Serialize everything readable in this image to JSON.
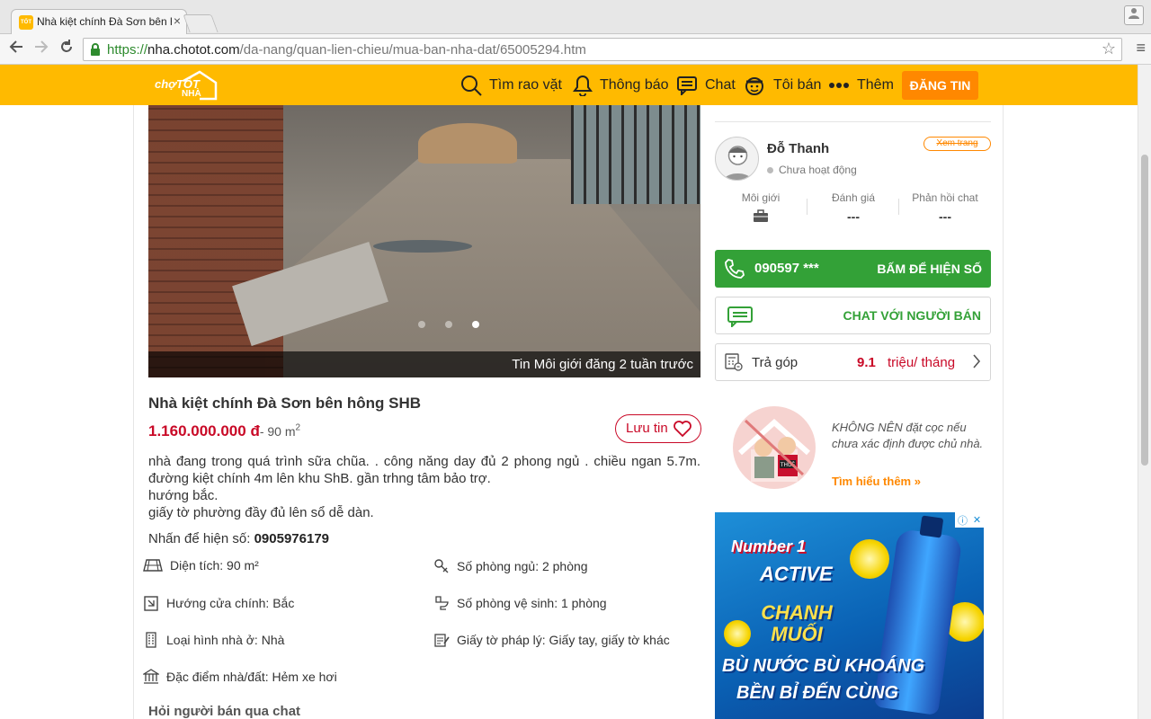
{
  "browser": {
    "tab_title": "Nhà kiệt chính Đà Sơn bên hông SHB",
    "tab_favicon_text": "TỐT",
    "tab_close": "×",
    "url_scheme": "https://",
    "url_host": "nha.chotot.com",
    "url_path": "/da-nang/quan-lien-chieu/mua-ban-nha-dat/65005294.htm"
  },
  "header": {
    "logo_text": "chợTỐT",
    "logo_sub": "NHÀ",
    "nav": [
      {
        "label": "Tìm rao vặt",
        "icon": "search-icon"
      },
      {
        "label": "Thông báo",
        "icon": "bell-icon"
      },
      {
        "label": "Chat",
        "icon": "chat-icon"
      },
      {
        "label": "Tôi bán",
        "icon": "seller-icon"
      },
      {
        "label": "Thêm",
        "icon": "more-icon"
      }
    ],
    "post_button": "ĐĂNG TIN",
    "brand_color": "#ffba00",
    "post_color": "#ff8800"
  },
  "listing": {
    "photo_caption": "Tin Môi giới đăng 2 tuần trước",
    "photo_count": 3,
    "photo_active_index": 2,
    "title": "Nhà kiệt chính Đà Sơn bên hông SHB",
    "price": "1.160.000.000 đ",
    "area": "- 90 m",
    "area_sup": "2",
    "save_label": "Lưu tin",
    "description": [
      "nhà đang trong quá trình sữa chũa. . công năng day đủ 2 phong ngủ . chiều ngan 5.7m. đường kiệt chính 4m lên khu ShB. gần trhng tâm bảo trợ.",
      "hướng bắc.",
      "giấy tờ phường đầy đủ lên sổ dễ dàn."
    ],
    "phone_prompt": "Nhấn để hiện số:",
    "phone_number": "0905976179",
    "params": [
      {
        "label": "Diện tích: 90 m²",
        "icon": "area-icon"
      },
      {
        "label": "Số phòng ngủ: 2 phòng",
        "icon": "key-icon"
      },
      {
        "label": "Hướng cửa chính: Bắc",
        "icon": "door-icon"
      },
      {
        "label": "Số phòng vệ sinh: 1 phòng",
        "icon": "toilet-icon"
      },
      {
        "label": "Loại hình nhà ở: Nhà",
        "icon": "building-icon"
      },
      {
        "label": "Giấy tờ pháp lý: Giấy tay, giấy tờ khác",
        "icon": "document-icon"
      },
      {
        "label": "Đặc điểm nhà/đất: Hẻm xe hơi",
        "icon": "bank-icon"
      }
    ],
    "ask_seller": "Hỏi người bán qua chat",
    "price_color": "#c90927"
  },
  "seller": {
    "name": "Đỗ Thanh",
    "status": "Chưa hoạt động",
    "view_page": "Xem trang",
    "stats": [
      {
        "label": "Môi giới",
        "value": ""
      },
      {
        "label": "Đánh giá",
        "value": "---"
      },
      {
        "label": "Phản hồi chat",
        "value": "---"
      }
    ],
    "call_number": "090597 ***",
    "call_cta": "BẤM ĐỂ HIỆN SỐ",
    "chat_label": "CHAT VỚI NGƯỜI BÁN",
    "installment_label": "Trả góp",
    "installment_value": "9.1",
    "installment_unit": "triệu/ tháng",
    "green": "#33a137"
  },
  "warning": {
    "text": "KHÔNG NÊN đặt cọc nếu chưa xác định được chủ nhà.",
    "link": "Tìm hiểu thêm »"
  },
  "ad": {
    "brand": "Number 1",
    "product": "ACTIVE",
    "flavor": "CHANH MUỐI",
    "slogan_1": "BÙ NƯỚC BÙ KHOÁNG",
    "slogan_2": "BỀN BỈ ĐẾN CÙNG"
  }
}
